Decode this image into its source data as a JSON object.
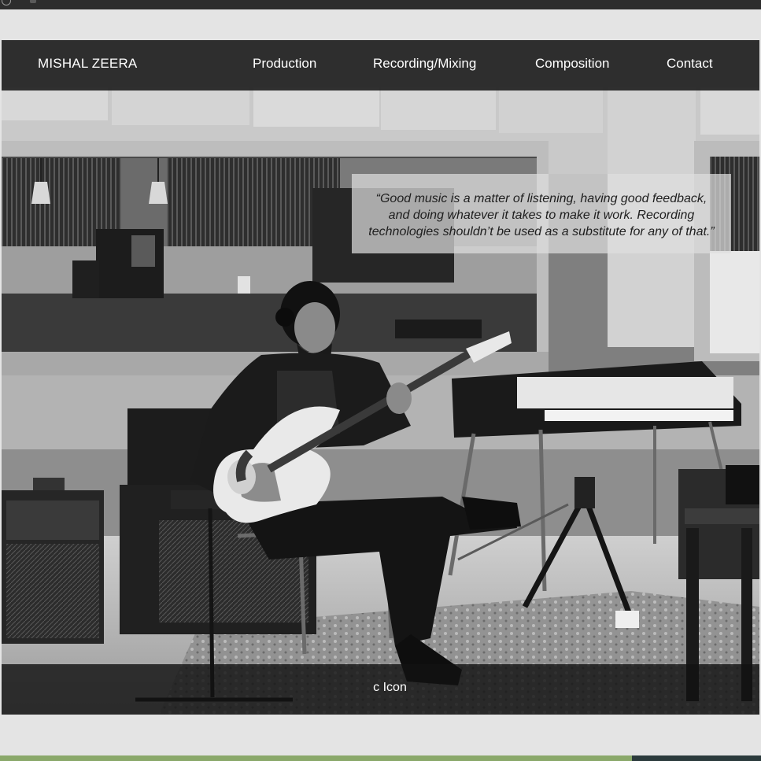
{
  "site": {
    "brand": "MISHAL ZEERA"
  },
  "nav": {
    "items": [
      {
        "label": "Production"
      },
      {
        "label": "Recording/Mixing"
      },
      {
        "label": "Composition"
      },
      {
        "label": "Contact"
      }
    ]
  },
  "hero": {
    "quote_lines": [
      "“Good music is a matter of listening, having good feedback,",
      "and doing whatever it takes to make it work. Recording",
      "technologies shouldn’t be used as a substitute for any of that.”"
    ],
    "photo_subject": "musician playing electric bass guitar in recording studio"
  },
  "footer": {
    "text": "c Icon"
  },
  "colors": {
    "navbar_bg": "#222222",
    "footer_bg": "#121212",
    "page_bg": "#e4e4e4",
    "nav_text": "#ffffff"
  }
}
